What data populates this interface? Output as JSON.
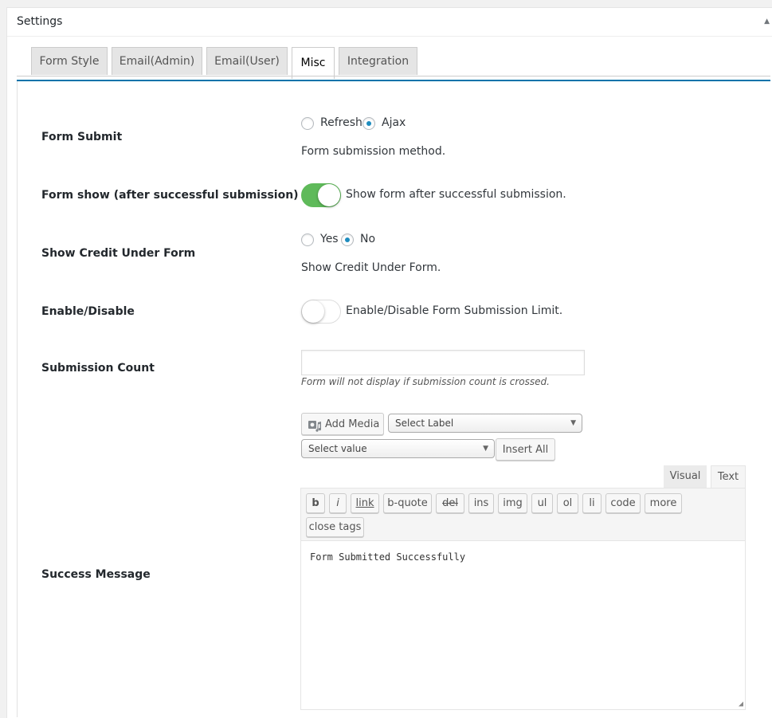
{
  "header": {
    "title": "Settings",
    "toggle_icon": "triangle-up-icon",
    "toggle_glyph": "▲"
  },
  "tabs": [
    {
      "label": "Form Style",
      "active": false
    },
    {
      "label": "Email(Admin)",
      "active": false
    },
    {
      "label": "Email(User)",
      "active": false
    },
    {
      "label": "Misc",
      "active": true
    },
    {
      "label": "Integration",
      "active": false
    }
  ],
  "form_submit": {
    "label": "Form Submit",
    "options": [
      {
        "label": "Refresh",
        "checked": false
      },
      {
        "label": "Ajax",
        "checked": true
      }
    ],
    "description": "Form submission method."
  },
  "form_show": {
    "label": "Form show (after successful submission)",
    "enabled": true,
    "description": "Show form after successful submission."
  },
  "show_credit": {
    "label": "Show Credit Under Form",
    "options": [
      {
        "label": "Yes",
        "checked": false
      },
      {
        "label": "No",
        "checked": true
      }
    ],
    "description": "Show Credit Under Form."
  },
  "enable_disable": {
    "label": "Enable/Disable",
    "enabled": false,
    "description": "Enable/Disable Form Submission Limit."
  },
  "submission_count": {
    "label": "Submission Count",
    "value": "",
    "hint": "Form will not display if submission count is crossed."
  },
  "success_message": {
    "label": "Success Message",
    "add_media": "Add Media",
    "select_label": "Select Label",
    "select_value": "Select value",
    "insert_all": "Insert All",
    "editor_tabs": {
      "visual": "Visual",
      "text": "Text",
      "active": "Text"
    },
    "quicktags": [
      "b",
      "i",
      "link",
      "b-quote",
      "del",
      "ins",
      "img",
      "ul",
      "ol",
      "li",
      "code",
      "more",
      "close tags"
    ],
    "content": "Form Submitted Successfully"
  },
  "colors": {
    "accent": "#0073aa",
    "toggle_on": "#5fba5a",
    "radio_dot": "#1e8cbe"
  }
}
